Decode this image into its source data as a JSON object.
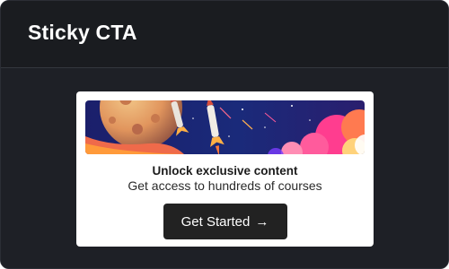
{
  "header": {
    "title": "Sticky CTA"
  },
  "card": {
    "banner_icon": "rocket-space-illustration",
    "headline": "Unlock exclusive content",
    "subtext": "Get access to hundreds of courses",
    "cta_label": "Get Started",
    "cta_icon": "arrow-right-icon",
    "cta_arrow": "→"
  },
  "colors": {
    "window_bg": "#1e2026",
    "header_bg": "#1a1c20",
    "card_bg": "#ffffff",
    "cta_bg": "#222222"
  }
}
